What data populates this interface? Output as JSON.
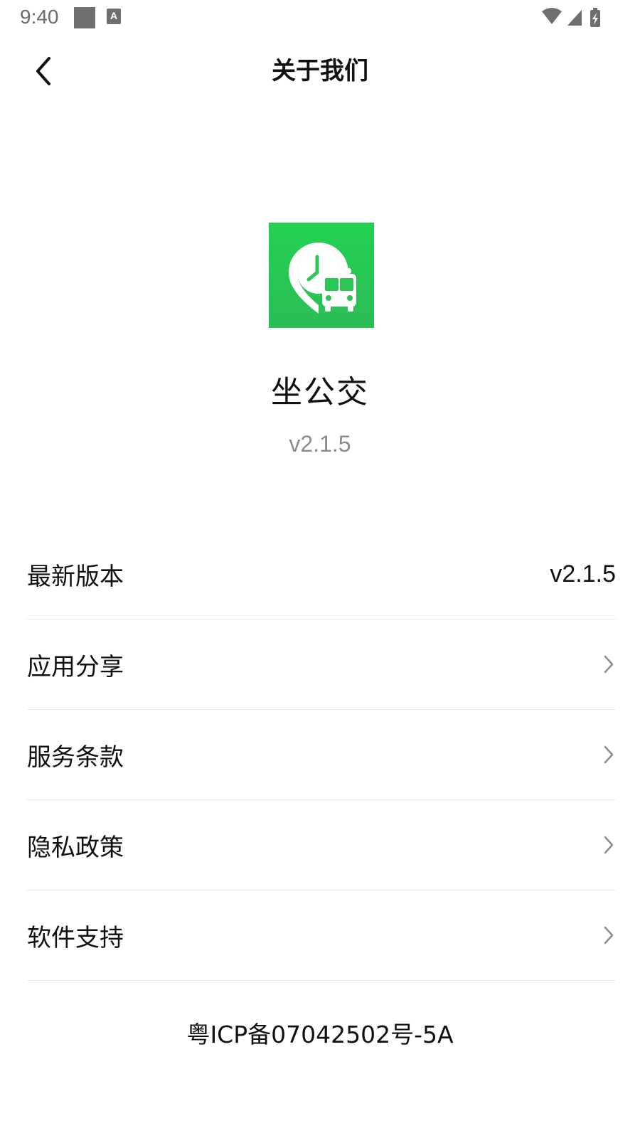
{
  "status_bar": {
    "time": "9:40",
    "keyboard_icon_letter": "A",
    "icons": [
      "notification-square-icon",
      "keyboard-icon",
      "wifi-icon",
      "cellular-signal-icon",
      "battery-charging-icon"
    ]
  },
  "header": {
    "title": "关于我们",
    "back_icon": "chevron-left-icon"
  },
  "app": {
    "name": "坐公交",
    "version": "v2.1.5",
    "logo_icon": "bus-stop-clock-logo",
    "logo_color": "#22c653"
  },
  "menu": {
    "items": [
      {
        "label": "最新版本",
        "value": "v2.1.5",
        "has_chevron": false
      },
      {
        "label": "应用分享",
        "value": "",
        "has_chevron": true
      },
      {
        "label": "服务条款",
        "value": "",
        "has_chevron": true
      },
      {
        "label": "隐私政策",
        "value": "",
        "has_chevron": true
      },
      {
        "label": "软件支持",
        "value": "",
        "has_chevron": true
      }
    ]
  },
  "footer": {
    "icp": "粤ICP备07042502号-5A"
  },
  "colors": {
    "background": "#ffffff",
    "text_primary": "#111111",
    "text_secondary": "#8c8c8c",
    "divider": "#ececec",
    "brand_green": "#22c653"
  }
}
